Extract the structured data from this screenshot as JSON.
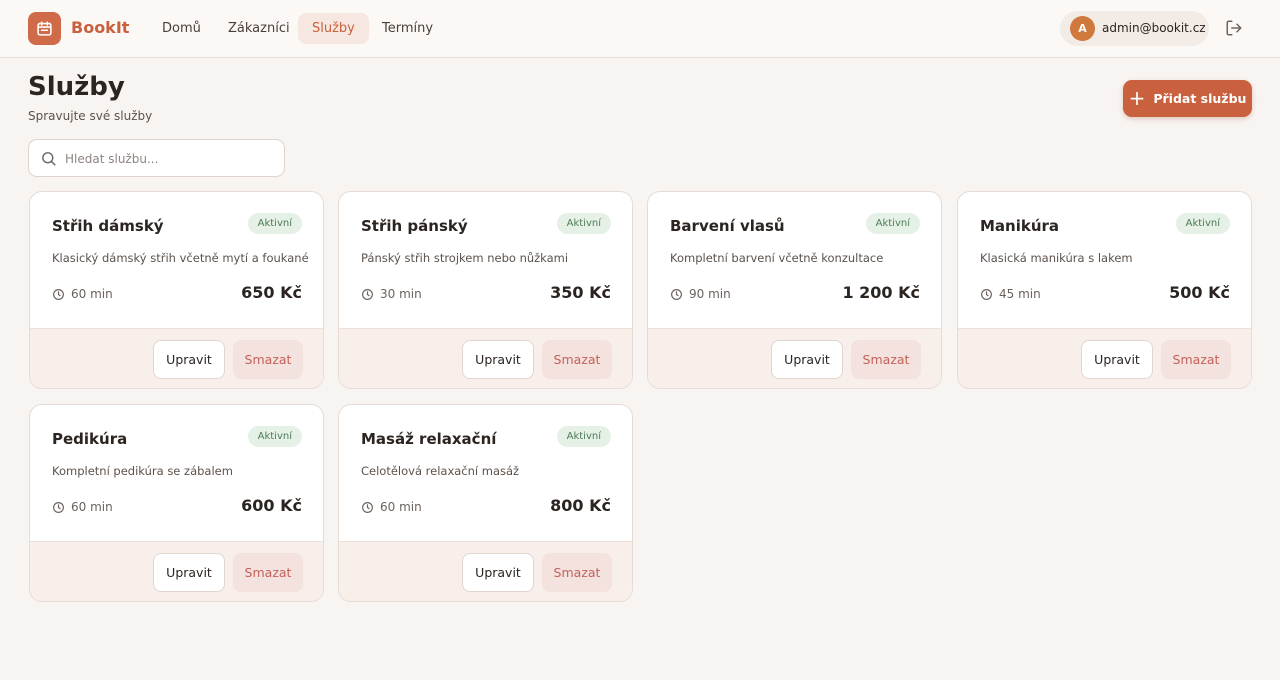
{
  "header": {
    "brand": "BookIt",
    "nav": [
      {
        "label": "Domů",
        "active": false
      },
      {
        "label": "Zákazníci",
        "active": false
      },
      {
        "label": "Služby",
        "active": true
      },
      {
        "label": "Termíny",
        "active": false
      }
    ],
    "user": {
      "initial": "A",
      "email": "admin@bookit.cz"
    }
  },
  "page": {
    "title": "Služby",
    "subtitle": "Spravujte své služby",
    "add_button": "Přidat službu",
    "search_placeholder": "Hledat službu..."
  },
  "services": [
    {
      "name": "Střih dámský",
      "status": "Aktivní",
      "description": "Klasický dámský střih včetně mytí a foukané",
      "duration": "60 min",
      "price": "650 Kč",
      "edit": "Upravit",
      "delete": "Smazat"
    },
    {
      "name": "Střih pánský",
      "status": "Aktivní",
      "description": "Pánský střih strojkem nebo nůžkami",
      "duration": "30 min",
      "price": "350 Kč",
      "edit": "Upravit",
      "delete": "Smazat"
    },
    {
      "name": "Barvení vlasů",
      "status": "Aktivní",
      "description": "Kompletní barvení včetně konzultace",
      "duration": "90 min",
      "price": "1 200 Kč",
      "edit": "Upravit",
      "delete": "Smazat"
    },
    {
      "name": "Manikúra",
      "status": "Aktivní",
      "description": "Klasická manikúra s lakem",
      "duration": "45 min",
      "price": "500 Kč",
      "edit": "Upravit",
      "delete": "Smazat"
    },
    {
      "name": "Pedikúra",
      "status": "Aktivní",
      "description": "Kompletní pedikúra se zábalem",
      "duration": "60 min",
      "price": "600 Kč",
      "edit": "Upravit",
      "delete": "Smazat"
    },
    {
      "name": "Masáž relaxační",
      "status": "Aktivní",
      "description": "Celotělová relaxační masáž",
      "duration": "60 min",
      "price": "800 Kč",
      "edit": "Upravit",
      "delete": "Smazat"
    }
  ],
  "colors": {
    "accent": "#c9603e",
    "background": "#f8f4f1",
    "badge": "#e5f0e6",
    "danger": "#c4615a"
  }
}
